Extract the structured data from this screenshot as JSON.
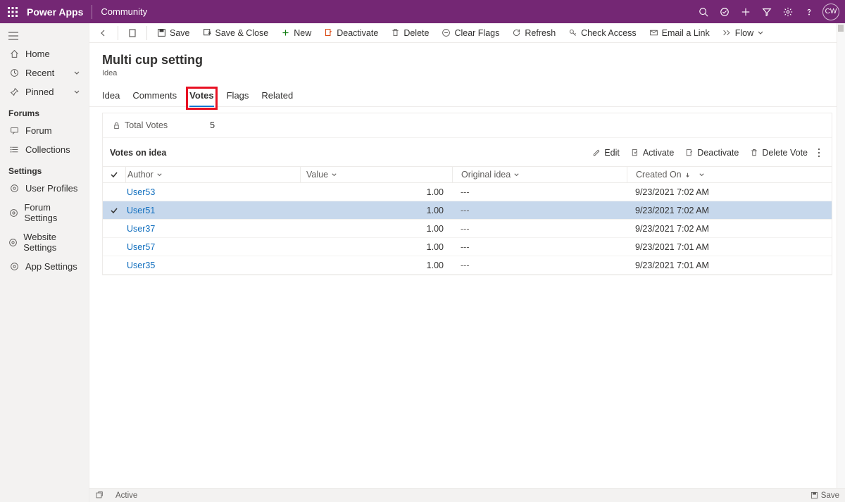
{
  "topbar": {
    "brand": "Power Apps",
    "context": "Community",
    "avatar_initials": "CW"
  },
  "leftnav": {
    "home": "Home",
    "recent": "Recent",
    "pinned": "Pinned",
    "section_forums": "Forums",
    "forum": "Forum",
    "collections": "Collections",
    "section_settings": "Settings",
    "user_profiles": "User Profiles",
    "forum_settings": "Forum Settings",
    "website_settings": "Website Settings",
    "app_settings": "App Settings"
  },
  "cmd": {
    "save": "Save",
    "save_close": "Save & Close",
    "new": "New",
    "deactivate": "Deactivate",
    "delete": "Delete",
    "clear_flags": "Clear Flags",
    "refresh": "Refresh",
    "check_access": "Check Access",
    "email_link": "Email a Link",
    "flow": "Flow"
  },
  "header": {
    "title": "Multi cup setting",
    "subtitle": "Idea"
  },
  "tabs": {
    "idea": "Idea",
    "comments": "Comments",
    "votes": "Votes",
    "flags": "Flags",
    "related": "Related",
    "active": "votes"
  },
  "total_votes": {
    "label": "Total Votes",
    "value": "5"
  },
  "subgrid": {
    "title": "Votes on idea",
    "actions": {
      "edit": "Edit",
      "activate": "Activate",
      "deactivate": "Deactivate",
      "delete_vote": "Delete Vote"
    },
    "cols": {
      "author": "Author",
      "value": "Value",
      "original": "Original idea",
      "created": "Created On"
    },
    "rows": [
      {
        "author": "User53",
        "value": "1.00",
        "original": "---",
        "created": "9/23/2021 7:02 AM",
        "selected": false
      },
      {
        "author": "User51",
        "value": "1.00",
        "original": "---",
        "created": "9/23/2021 7:02 AM",
        "selected": true
      },
      {
        "author": "User37",
        "value": "1.00",
        "original": "---",
        "created": "9/23/2021 7:02 AM",
        "selected": false
      },
      {
        "author": "User57",
        "value": "1.00",
        "original": "---",
        "created": "9/23/2021 7:01 AM",
        "selected": false
      },
      {
        "author": "User35",
        "value": "1.00",
        "original": "---",
        "created": "9/23/2021 7:01 AM",
        "selected": false
      }
    ]
  },
  "status": {
    "state": "Active",
    "save": "Save"
  }
}
